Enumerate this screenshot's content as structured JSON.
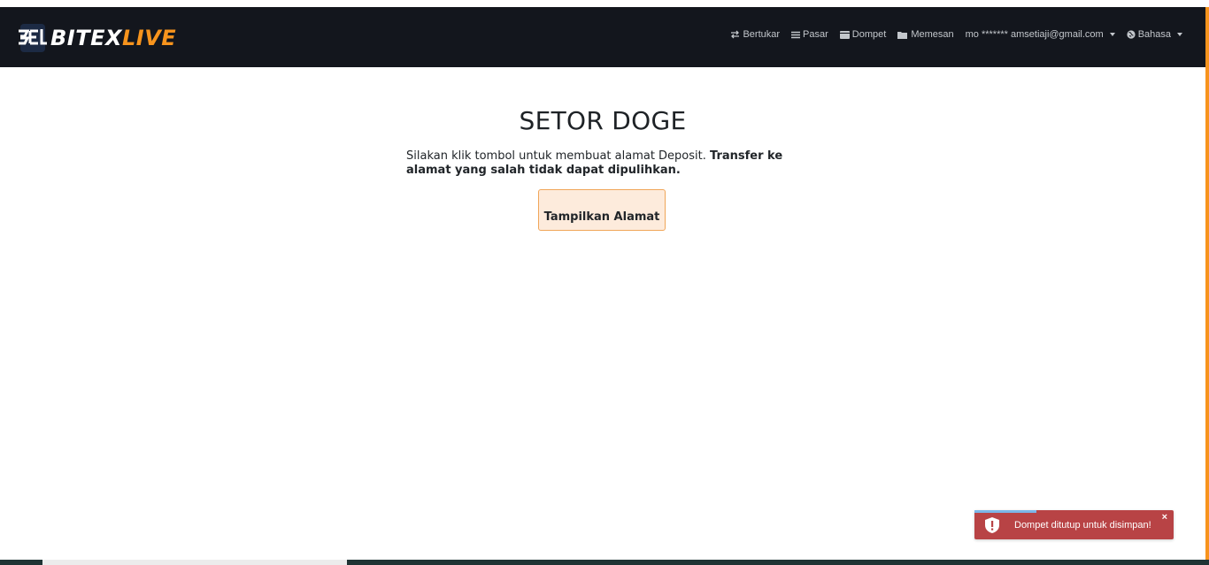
{
  "brand": {
    "part1": "BITEX",
    "part2": "LIVE",
    "accent_color": "#f7941d"
  },
  "nav": {
    "items": [
      {
        "label": "Bertukar",
        "icon": "exchange-icon"
      },
      {
        "label": "Pasar",
        "icon": "list-icon"
      },
      {
        "label": "Dompet",
        "icon": "wallet-icon"
      },
      {
        "label": "Memesan",
        "icon": "folder-icon"
      }
    ],
    "user": "mo ******* amsetiaji@gmail.com",
    "language": "Bahasa"
  },
  "main": {
    "title": "SETOR DOGE",
    "description_normal": "Silakan klik tombol untuk membuat alamat Deposit.",
    "description_bold": "Transfer ke alamat yang salah tidak dapat dipulihkan.",
    "show_button": "Tampilkan Alamat"
  },
  "toast": {
    "message": "Dompet ditutup untuk disimpan!",
    "close": "×",
    "color": "#b84345"
  }
}
